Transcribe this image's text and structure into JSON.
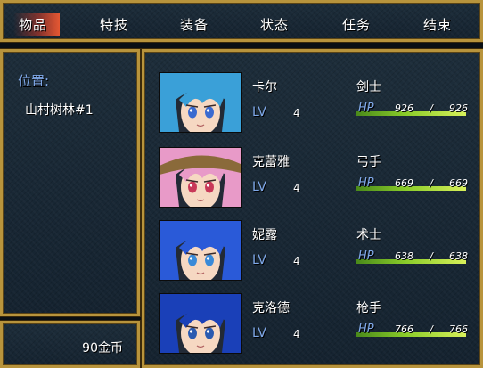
{
  "menu": {
    "items": [
      "物品",
      "特技",
      "装备",
      "状态",
      "任务",
      "结束"
    ],
    "selected_index": 0
  },
  "location": {
    "label": "位置:",
    "value": "山村树林#1"
  },
  "gold": {
    "amount": "90金币"
  },
  "party": [
    {
      "name": "卡尔",
      "class": "剑士",
      "lv_label": "LV",
      "level": "4",
      "hp_label": "HP",
      "hp_current": "926",
      "hp_sep": "/",
      "hp_max": "926",
      "hp_ratio": 1.0,
      "hair_color": "#3aa0d8",
      "eye_color": "#3a6ad0"
    },
    {
      "name": "克蕾雅",
      "class": "弓手",
      "lv_label": "LV",
      "level": "4",
      "hp_label": "HP",
      "hp_current": "669",
      "hp_sep": "/",
      "hp_max": "669",
      "hp_ratio": 1.0,
      "hair_color": "#e89ac8",
      "eye_color": "#c83858"
    },
    {
      "name": "妮露",
      "class": "术士",
      "lv_label": "LV",
      "level": "4",
      "hp_label": "HP",
      "hp_current": "638",
      "hp_sep": "/",
      "hp_max": "638",
      "hp_ratio": 1.0,
      "hair_color": "#2a5ad8",
      "eye_color": "#3a8ad8"
    },
    {
      "name": "克洛德",
      "class": "枪手",
      "lv_label": "LV",
      "level": "4",
      "hp_label": "HP",
      "hp_current": "766",
      "hp_sep": "/",
      "hp_max": "766",
      "hp_ratio": 1.0,
      "hair_color": "#1a40b8",
      "eye_color": "#2a5ab0"
    }
  ],
  "colors": {
    "frame_gold": "#b8943c",
    "panel_bg": "#1a2834",
    "label_blue": "#7fa8e8",
    "hp_green": "#8acc2a"
  }
}
